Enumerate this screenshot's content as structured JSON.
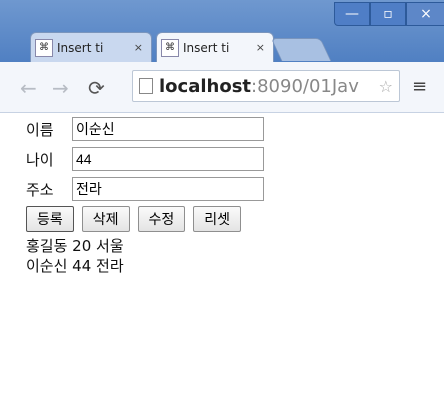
{
  "browser": {
    "tabs": [
      {
        "title": "Insert ti",
        "close": "×"
      },
      {
        "title": "Insert ti",
        "close": "×"
      }
    ],
    "url_host": "localhost",
    "url_path": ":8090/01Jav",
    "menu_icon": "≡"
  },
  "form": {
    "name_label": "이름",
    "name_value": "이순신",
    "age_label": "나이",
    "age_value": "44",
    "address_label": "주소",
    "address_value": "전라",
    "buttons": {
      "register": "등록",
      "delete": "삭제",
      "edit": "수정",
      "reset": "리셋"
    }
  },
  "output": {
    "line1": "홍길동 20 서울",
    "line2": "이순신 44 전라"
  }
}
